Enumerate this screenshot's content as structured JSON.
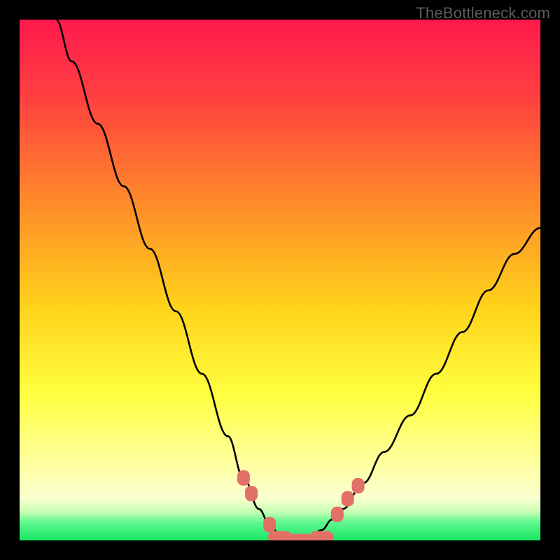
{
  "watermark": "TheBottleneck.com",
  "colors": {
    "frame": "#000000",
    "grad_top": "#ff1a4d",
    "grad_mid_upper": "#ff5a3a",
    "grad_mid": "#ffc21a",
    "grad_lower": "#ffff66",
    "grad_pale": "#ffffb0",
    "grad_green": "#2cf87a",
    "curve": "#000000",
    "marker": "#e27066"
  },
  "chart_data": {
    "type": "line",
    "title": "",
    "xlabel": "",
    "ylabel": "",
    "xlim": [
      0,
      100
    ],
    "ylim": [
      0,
      100
    ],
    "grid": false,
    "legend": false,
    "series": [
      {
        "name": "curve",
        "x": [
          7,
          10,
          15,
          20,
          25,
          30,
          35,
          40,
          43,
          46,
          48,
          50,
          52,
          54,
          56,
          58,
          60,
          62,
          66,
          70,
          75,
          80,
          85,
          90,
          95,
          100
        ],
        "y": [
          100,
          92,
          80,
          68,
          56,
          44,
          32,
          20,
          12,
          6,
          3,
          1,
          0.2,
          0.2,
          0.8,
          2,
          4,
          6,
          11,
          17,
          24,
          32,
          40,
          48,
          55,
          60
        ]
      }
    ],
    "markers": [
      {
        "x": 43,
        "y": 12,
        "shape": "round"
      },
      {
        "x": 44.5,
        "y": 9,
        "shape": "round"
      },
      {
        "x": 48,
        "y": 3,
        "shape": "round"
      },
      {
        "x": 50,
        "y": 0.7,
        "shape": "bar"
      },
      {
        "x": 54,
        "y": 0.2,
        "shape": "bar"
      },
      {
        "x": 58,
        "y": 0.7,
        "shape": "bar"
      },
      {
        "x": 61,
        "y": 5,
        "shape": "round"
      },
      {
        "x": 63,
        "y": 8,
        "shape": "round"
      },
      {
        "x": 65,
        "y": 10.5,
        "shape": "round"
      }
    ],
    "gradient_stops": [
      {
        "offset": 0.0,
        "color": "#ff1a4d"
      },
      {
        "offset": 0.15,
        "color": "#ff4040"
      },
      {
        "offset": 0.35,
        "color": "#ff8a2a"
      },
      {
        "offset": 0.55,
        "color": "#ffd21a"
      },
      {
        "offset": 0.72,
        "color": "#ffff40"
      },
      {
        "offset": 0.86,
        "color": "#ffffa6"
      },
      {
        "offset": 0.92,
        "color": "#f9ffd0"
      },
      {
        "offset": 0.945,
        "color": "#c8ffb4"
      },
      {
        "offset": 0.965,
        "color": "#60f890"
      },
      {
        "offset": 1.0,
        "color": "#17e662"
      }
    ]
  }
}
